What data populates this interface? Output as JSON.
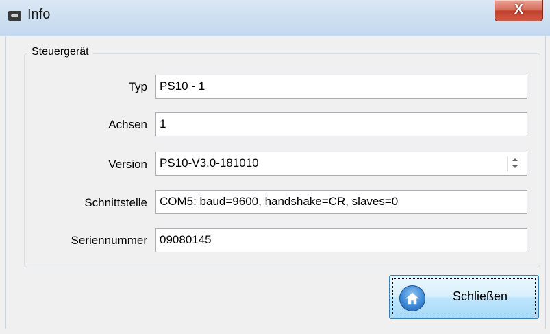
{
  "window": {
    "title": "Info",
    "close_symbol": "X"
  },
  "group": {
    "label": "Steuergerät",
    "rows": [
      {
        "label": "Typ",
        "value": "PS10 - 1"
      },
      {
        "label": "Achsen",
        "value": "1"
      },
      {
        "label": "Version",
        "value": "PS10-V3.0-181010"
      },
      {
        "label": "Schnittstelle",
        "value": "COM5: baud=9600, handshake=CR, slaves=0"
      },
      {
        "label": "Seriennummer",
        "value": "09080145"
      }
    ]
  },
  "buttons": {
    "close_label": "Schließen"
  },
  "icons": {
    "app": "app-icon",
    "close": "close-icon",
    "home": "home-icon",
    "spinner": "spinner-icon"
  }
}
